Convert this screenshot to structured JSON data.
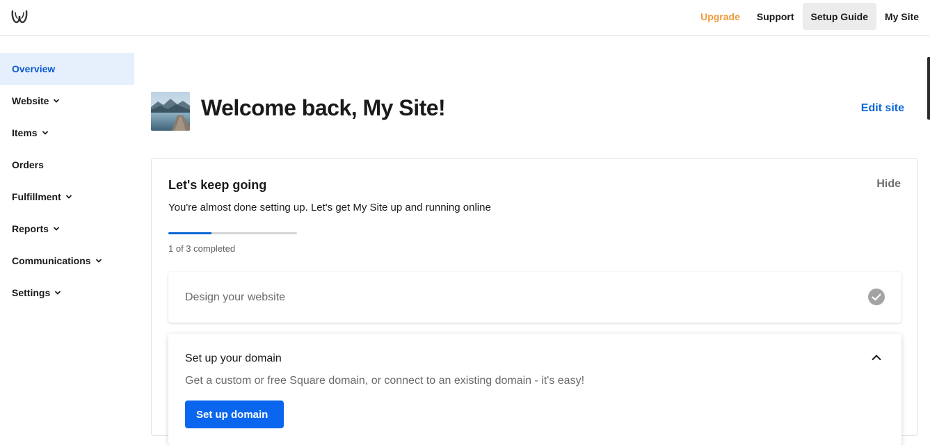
{
  "header": {
    "logo_icon": "weebly-w-logo",
    "nav": {
      "upgrade": "Upgrade",
      "support": "Support",
      "setup_guide": "Setup Guide",
      "my_site": "My Site"
    },
    "upgrade_color": "#ef9a3c"
  },
  "sidebar": {
    "items": [
      {
        "label": "Overview",
        "active": true
      },
      {
        "label": "Website",
        "has_chevron": true
      },
      {
        "label": "Items",
        "has_chevron": true
      },
      {
        "label": "Orders"
      },
      {
        "label": "Fulfillment",
        "has_chevron": true
      },
      {
        "label": "Reports",
        "has_chevron": true
      },
      {
        "label": "Communications",
        "has_chevron": true
      },
      {
        "label": "Settings",
        "has_chevron": true
      }
    ]
  },
  "main": {
    "welcome_title": "Welcome back, My Site!",
    "edit_site": "Edit site",
    "setup_card": {
      "title": "Let's keep going",
      "hide": "Hide",
      "subtitle": "You're almost done setting up. Let's get My Site up and running online",
      "progress_completed": 1,
      "progress_total": 3,
      "progress_text": "1 of 3 completed",
      "steps": [
        {
          "label": "Design your website",
          "completed": true
        },
        {
          "label": "Set up your domain",
          "description": "Get a custom or free Square domain, or connect to an existing domain - it's easy!",
          "button": "Set up domain",
          "expanded": true
        }
      ]
    }
  },
  "colors": {
    "accent": "#0a66d6",
    "active_bg": "#e6f0fc"
  }
}
